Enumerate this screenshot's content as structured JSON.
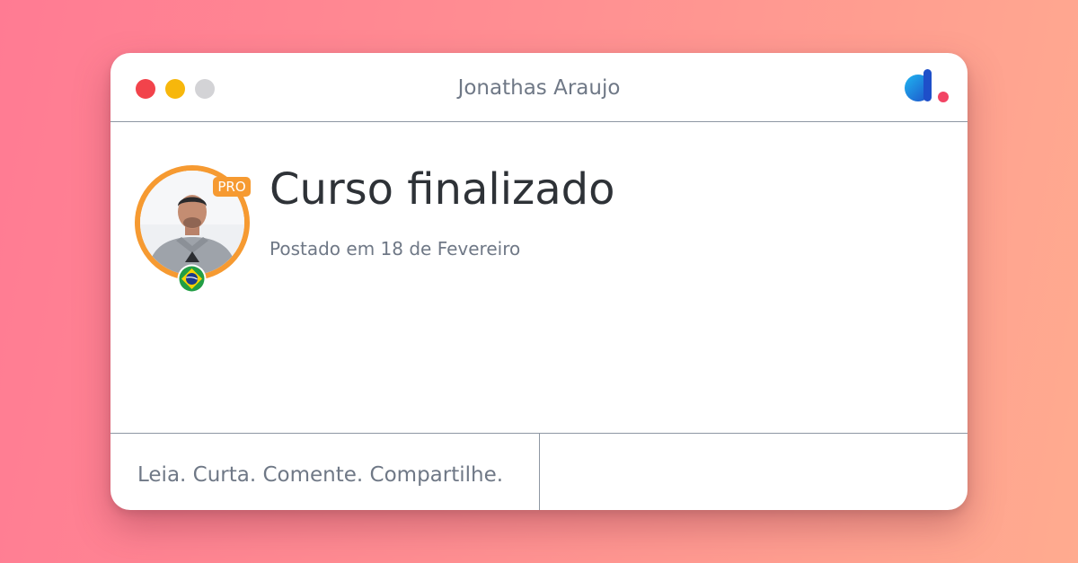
{
  "window": {
    "title": "Jonathas Araujo",
    "controls": [
      "close",
      "minimize",
      "maximize"
    ],
    "logo_icon": "dev-logo-icon"
  },
  "post": {
    "title": "Curso finalizado",
    "date": "Postado em 18 de Fevereiro"
  },
  "author": {
    "badge": "PRO",
    "avatar_icon": "avatar",
    "flag_icon": "brazil-flag-icon"
  },
  "footer": {
    "tagline": "Leia. Curta. Comente. Compartilhe."
  },
  "colors": {
    "background_start": "#ff7b93",
    "background_end": "#ffab8f",
    "accent_orange": "#f69a31",
    "close_red": "#f2434b",
    "minimize_yellow": "#f7b70c",
    "maximize_gray": "#d3d3d6",
    "text_dark": "#2e3237",
    "text_muted": "#6f7886"
  }
}
